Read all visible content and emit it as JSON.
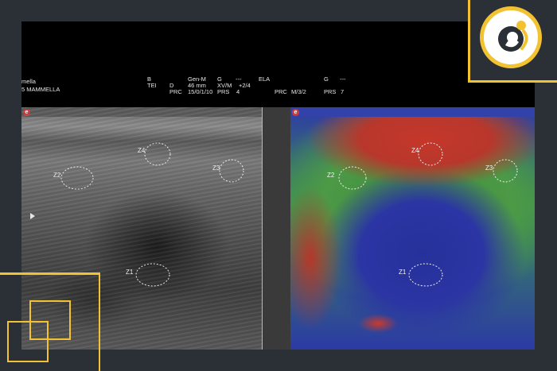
{
  "header": {
    "left_line1": "mella",
    "left_line2": "5 MAMMELLA",
    "col_b_1": "B",
    "col_b_2": "TEI",
    "col_genm_1": "Gen-M",
    "col_genm_2": "46 mm",
    "col_g_1": "G",
    "col_g_dash": "---",
    "col_g_2": "XV/M",
    "col_g_val": "+2/4",
    "col_d": "D",
    "col_prc_1": "PRC",
    "col_prc_1_val": "15/0/1/10",
    "col_prs_1": "PRS",
    "col_prs_1_val": "4",
    "col_ela": "ELA",
    "col_prc_2": "PRC",
    "col_prc_2_val": "M/3/2",
    "col_g2": "G",
    "col_g2_dash": "---",
    "col_prs_2": "PRS",
    "col_prs_2_val": "7"
  },
  "bmode": {
    "badge": "e",
    "zones": [
      "Z4",
      "Z2",
      "Z3",
      "Z1"
    ]
  },
  "elastography": {
    "badge": "e",
    "zones": [
      "Z4",
      "Z2",
      "Z3",
      "Z1"
    ]
  },
  "colors": {
    "accent": "#f2c230",
    "background": "#2b2f36",
    "stiff": "#c5372a",
    "medium": "#4c9a46",
    "soft": "#2b35a4"
  }
}
